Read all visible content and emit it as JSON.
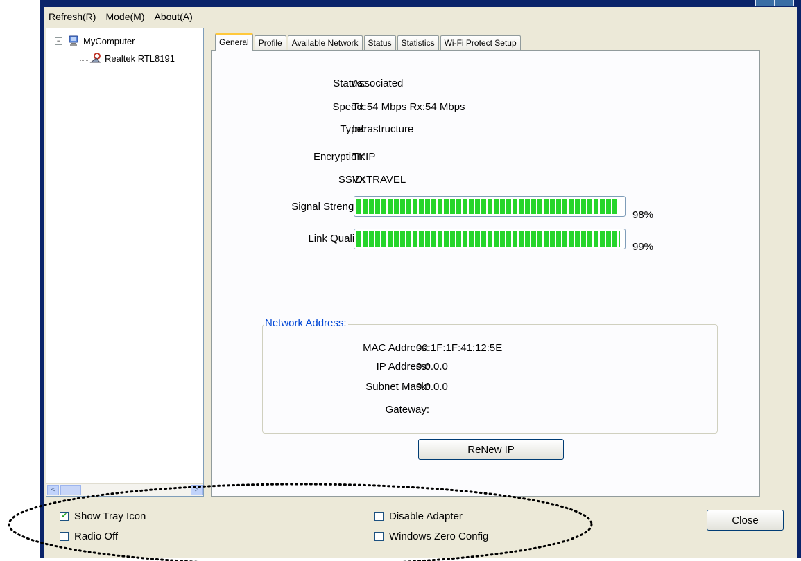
{
  "menu": [
    {
      "label": "Refresh(R)"
    },
    {
      "label": "Mode(M)"
    },
    {
      "label": "About(A)"
    }
  ],
  "tree": {
    "root": "MyComputer",
    "root_expander": "−",
    "adapter": "Realtek RTL8191"
  },
  "scrollbar": {
    "left_arrow": "<",
    "right_arrow": ">"
  },
  "tabs": [
    {
      "label": "General",
      "active": true
    },
    {
      "label": "Profile"
    },
    {
      "label": "Available Network"
    },
    {
      "label": "Status"
    },
    {
      "label": "Statistics"
    },
    {
      "label": "Wi-Fi Protect Setup"
    }
  ],
  "general": {
    "status_label": "Status:",
    "status_value": "Associated",
    "speed_label": "Speed:",
    "speed_value": "Tx:54 Mbps Rx:54 Mbps",
    "type_label": "Type:",
    "type_value": "Infrastructure",
    "encryption_label": "Encryption:",
    "encryption_value": "TKIP",
    "ssid_label": "SSID:",
    "ssid_value": "VXTRAVEL",
    "signal_label": "Signal Strength:",
    "signal_value": 98,
    "signal_text": "98%",
    "link_label": "Link Quality:",
    "link_value": 99,
    "link_text": "99%"
  },
  "network": {
    "title": "Network Address:",
    "mac_label": "MAC Address:",
    "mac_value": "00:1F:1F:41:12:5E",
    "ip_label": "IP Address:",
    "ip_value": "0.0.0.0",
    "subnet_label": "Subnet Mask:",
    "subnet_value": "0.0.0.0",
    "gateway_label": "Gateway:",
    "gateway_value": ""
  },
  "renew_button": "ReNew IP",
  "options": {
    "show_tray": {
      "label": "Show Tray Icon",
      "checked": true
    },
    "radio_off": {
      "label": "Radio Off",
      "checked": false
    },
    "disable_adapter": {
      "label": "Disable Adapter",
      "checked": false
    },
    "zero_config": {
      "label": "Windows Zero Config",
      "checked": false
    }
  },
  "close_button": "Close",
  "colors": {
    "accent": "#0a246a",
    "signal_bar": "#26d52b",
    "group_title": "#0046d5"
  }
}
